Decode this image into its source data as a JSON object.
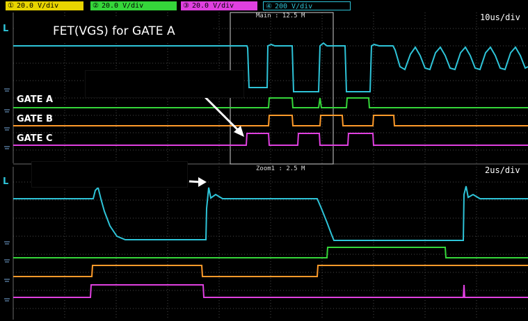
{
  "channels": [
    {
      "id": "1",
      "label": "20.0 V",
      "unit_suffix": "/div",
      "color": "#2ec4d8"
    },
    {
      "id": "2",
      "label": "20.0 V",
      "unit_suffix": "/div",
      "color": "#35d63a"
    },
    {
      "id": "3",
      "label": "20.0 V",
      "unit_suffix": "/div",
      "color": "#e040e0"
    },
    {
      "id": "4",
      "label": "200 V",
      "unit_suffix": "/div",
      "color": "#2ec4d8"
    }
  ],
  "main": {
    "timebase": "10us/div",
    "zoom_box_label": "Main : 12.5 M",
    "title": "FET(VGS) for GATE A",
    "trace_labels": [
      "GATE A",
      "GATE B",
      "GATE C"
    ]
  },
  "zoom": {
    "timebase": "2us/div",
    "label": "Zoom1 : 2.5 M"
  },
  "markers": {
    "level": "L",
    "ground": "⏚"
  },
  "colors": {
    "cyan": "#2ec4d8",
    "green": "#35d63a",
    "orange": "#ff9a2a",
    "magenta": "#e040e0",
    "grid": "#4a4a4a"
  }
}
